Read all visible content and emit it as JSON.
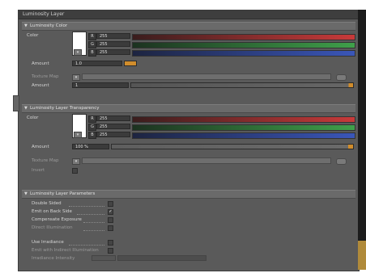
{
  "window": {
    "title": "Luminosity Layer"
  },
  "luminosity_color": {
    "header": "Luminosity Color",
    "color_label": "Color",
    "channels": [
      {
        "key": "R",
        "value": "255",
        "color": "#c83a3a",
        "level": 1.0
      },
      {
        "key": "G",
        "value": "255",
        "color": "#3fa04a",
        "level": 1.0
      },
      {
        "key": "B",
        "value": "255",
        "color": "#3a56b8",
        "level": 1.0
      }
    ],
    "amount_label": "Amount",
    "amount_value": "1.0",
    "texture_map_label": "Texture Map",
    "amount2_label": "Amount",
    "amount2_value": "1"
  },
  "luminosity_transparency": {
    "header": "Luminosity Layer Transparency",
    "color_label": "Color",
    "channels": [
      {
        "key": "R",
        "value": "255",
        "color": "#c83a3a",
        "level": 1.0
      },
      {
        "key": "G",
        "value": "255",
        "color": "#3fa04a",
        "level": 1.0
      },
      {
        "key": "B",
        "value": "255",
        "color": "#3a56b8",
        "level": 1.0
      }
    ],
    "amount_label": "Amount",
    "amount_value": "100 %",
    "texture_map_label": "Texture Map",
    "invert_label": "Invert"
  },
  "luminosity_params": {
    "header": "Luminosity Layer Parameters",
    "double_sided_label": "Double Sided",
    "emit_back_label": "Emit on Back Side",
    "compensate_label": "Compensate Exposure",
    "direct_illum_label": "Direct Illumination",
    "use_irradiance_label": "Use Irradiance",
    "emit_indirect_label": "Emit with Indirect Illumination",
    "irradiance_label": "Irradiance Intensity"
  },
  "colors": {
    "accent": "#d18d2c",
    "panel": "#5a5a5a"
  }
}
